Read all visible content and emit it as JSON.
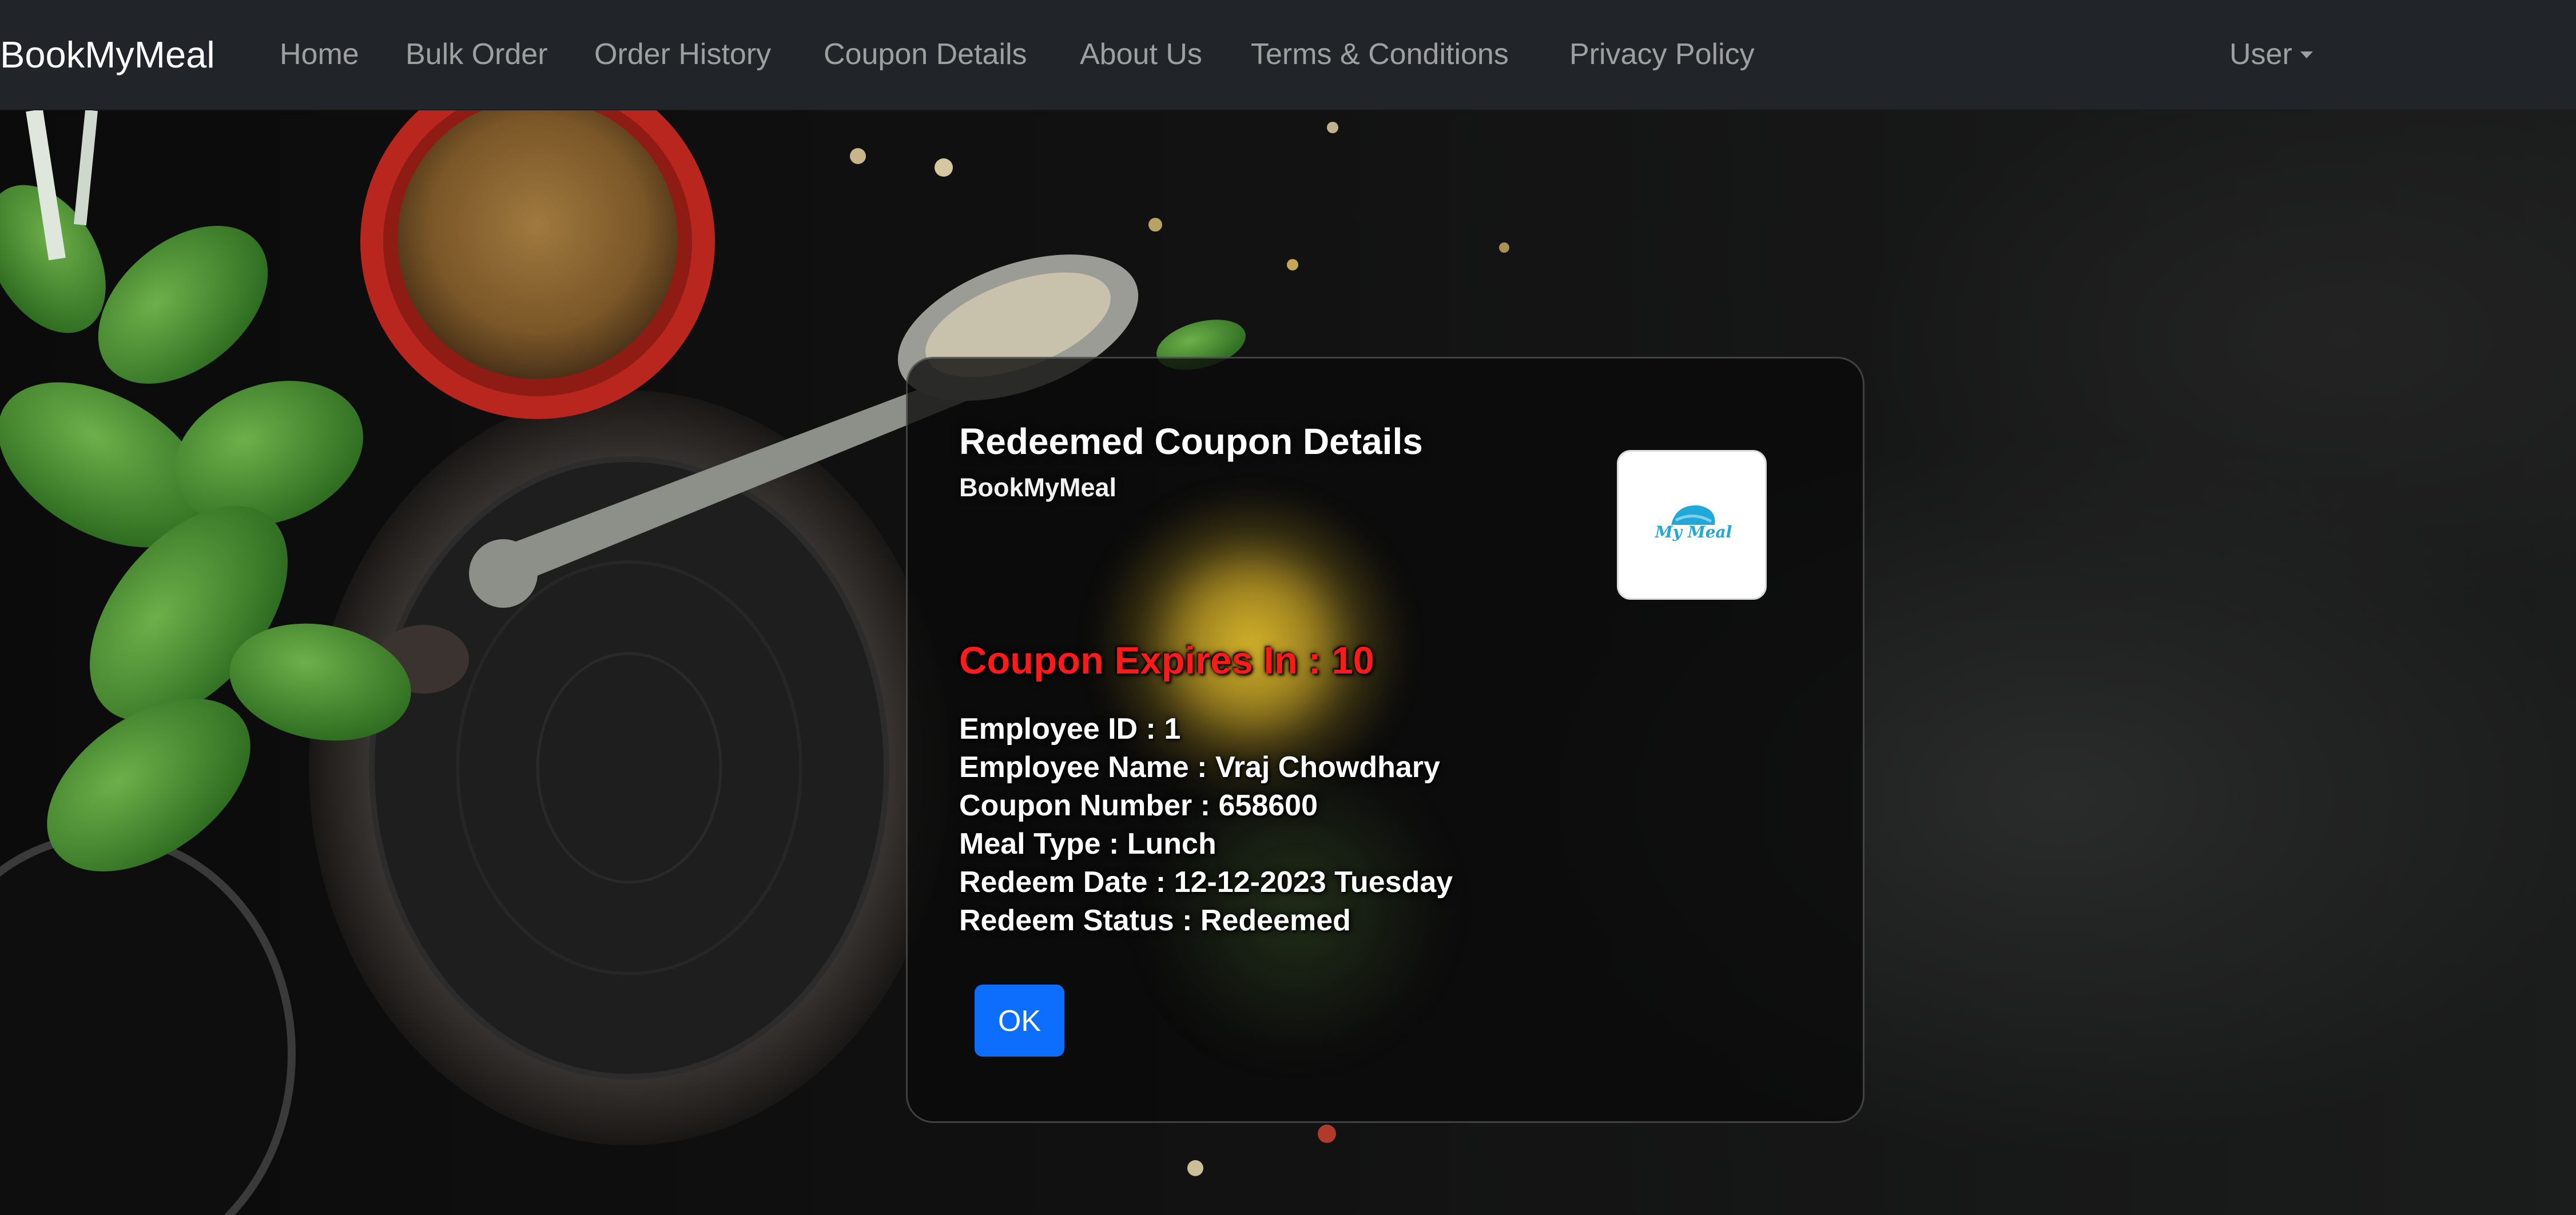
{
  "navbar": {
    "brand": "BookMyMeal",
    "links": [
      "Home",
      "Bulk Order",
      "Order History",
      "Coupon Details",
      "About Us",
      "Terms & Conditions",
      "Privacy Policy"
    ],
    "user_menu": "User"
  },
  "modal": {
    "title": "Redeemed Coupon Details",
    "subtitle": "BookMyMeal",
    "logo_text": "My Meal",
    "expires": "Coupon Expires In : 10",
    "details": [
      "Employee ID : 1",
      "Employee Name : Vraj Chowdhary",
      "Coupon Number : 658600",
      "Meal Type : Lunch",
      "Redeem Date : 12-12-2023 Tuesday",
      "Redeem Status : Redeemed"
    ],
    "ok_label": "OK"
  },
  "colors": {
    "navbar_bg": "#212529",
    "nav_link": "rgba(255,255,255,0.56)",
    "expire_text": "#ff1a1a",
    "ok_button": "#0d6efd",
    "logo_accent": "#1fa8d8"
  },
  "icons": {
    "user_menu": "caret-down-icon",
    "logo": "my-meal-logo"
  }
}
